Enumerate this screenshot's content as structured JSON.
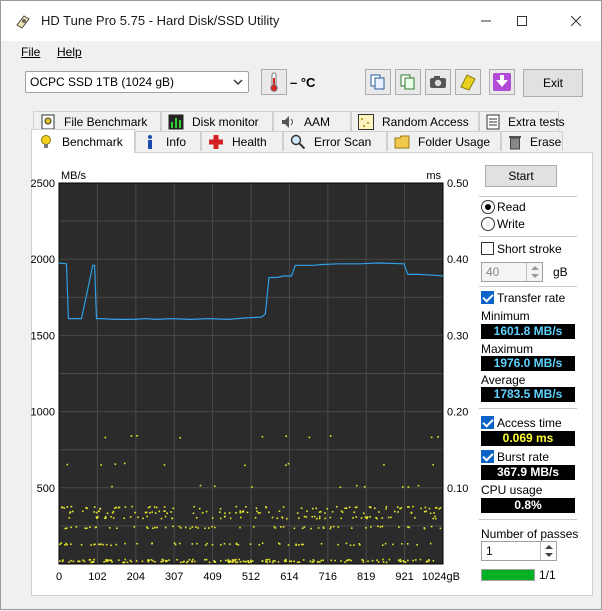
{
  "window": {
    "title": "HD Tune Pro 5.75 - Hard Disk/SSD Utility"
  },
  "menu": [
    {
      "label": "File"
    },
    {
      "label": "Help"
    }
  ],
  "toolbar": {
    "drive": "OCPC SSD 1TB (1024 gB)",
    "temperature": "– °C",
    "exit_label": "Exit",
    "icons": [
      "thermometer-icon",
      "copy-icon",
      "copy-all-icon",
      "camera-icon",
      "health-icon",
      "download-icon"
    ]
  },
  "tabs_top": [
    {
      "label": "File Benchmark",
      "icon": "file-benchmark-icon"
    },
    {
      "label": "Disk monitor",
      "icon": "disk-monitor-icon"
    },
    {
      "label": "AAM",
      "icon": "speaker-icon"
    },
    {
      "label": "Random Access",
      "icon": "random-access-icon"
    },
    {
      "label": "Extra tests",
      "icon": "extra-tests-icon"
    }
  ],
  "tabs_bottom": [
    {
      "label": "Benchmark",
      "icon": "lightbulb-icon",
      "active": true
    },
    {
      "label": "Info",
      "icon": "info-icon"
    },
    {
      "label": "Health",
      "icon": "health-cross-icon"
    },
    {
      "label": "Error Scan",
      "icon": "magnifier-icon"
    },
    {
      "label": "Folder Usage",
      "icon": "folder-icon"
    },
    {
      "label": "Erase",
      "icon": "trash-icon"
    }
  ],
  "side": {
    "start_label": "Start",
    "read_label": "Read",
    "write_label": "Write",
    "read_selected": true,
    "short_stroke_label": "Short stroke",
    "short_stroke_checked": false,
    "short_stroke_value": "40",
    "short_stroke_unit": "gB",
    "transfer_rate_label": "Transfer rate",
    "transfer_rate_checked": true,
    "minimum_label": "Minimum",
    "minimum_value": "1601.8 MB/s",
    "maximum_label": "Maximum",
    "maximum_value": "1976.0 MB/s",
    "average_label": "Average",
    "average_value": "1783.5 MB/s",
    "access_time_label": "Access time",
    "access_time_checked": true,
    "access_time_value": "0.069 ms",
    "burst_rate_label": "Burst rate",
    "burst_rate_checked": true,
    "burst_rate_value": "367.9 MB/s",
    "cpu_usage_label": "CPU usage",
    "cpu_usage_value": "0.8%",
    "passes_label": "Number of passes",
    "passes_value": "1",
    "progress_text": "1/1",
    "progress_fraction": 1.0
  },
  "colors": {
    "transfer_line": "#2f9fe6",
    "access_points": "#e6e62a",
    "chart_bg": "#2b2b2b",
    "grid": "#4a4a4a"
  },
  "chart_data": {
    "type": "line",
    "y_left_label": "MB/s",
    "y_right_label": "ms",
    "y_left_ticks": [
      "2500",
      "2000",
      "1500",
      "1000",
      "500"
    ],
    "y_right_ticks": [
      "0.50",
      "0.40",
      "0.30",
      "0.20",
      "0.10"
    ],
    "x_ticks": [
      "0",
      "102",
      "204",
      "307",
      "409",
      "512",
      "614",
      "716",
      "819",
      "921",
      "1024gB"
    ],
    "ylim_left": [
      0,
      2500
    ],
    "ylim_right": [
      0,
      0.5
    ],
    "xlim": [
      0,
      1024
    ],
    "grid": true,
    "series": [
      {
        "name": "Transfer rate",
        "axis": "left",
        "x": [
          0,
          20,
          25,
          30,
          60,
          90,
          95,
          100,
          103,
          110,
          150,
          200,
          230,
          260,
          300,
          350,
          400,
          450,
          500,
          540,
          550,
          560,
          580,
          600,
          620,
          630,
          680,
          700,
          750,
          800,
          850,
          920,
          930,
          960,
          1000,
          1024
        ],
        "y": [
          1975,
          1970,
          1610,
          1610,
          1610,
          1960,
          1960,
          1610,
          1610,
          1610,
          1605,
          1605,
          1610,
          1605,
          1610,
          1605,
          1610,
          1605,
          1615,
          1620,
          1640,
          1880,
          1880,
          1890,
          1890,
          1960,
          1960,
          1965,
          1970,
          1970,
          1975,
          1970,
          1900,
          1900,
          1895,
          1890
        ]
      }
    ],
    "access_time_bands_ms": [
      0.005,
      0.027,
      0.049,
      0.062,
      0.069,
      0.075,
      0.103,
      0.132,
      0.168
    ]
  }
}
